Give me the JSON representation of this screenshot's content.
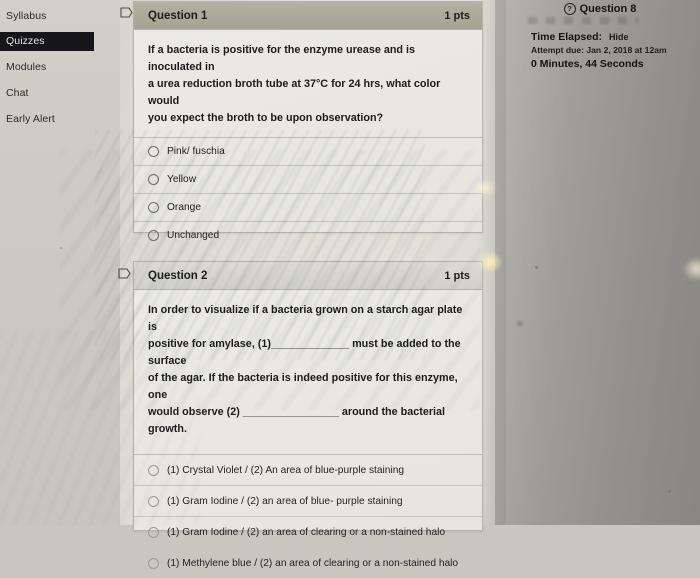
{
  "sidebar": {
    "items": [
      {
        "label": "Syllabus",
        "active": false
      },
      {
        "label": "Quizzes",
        "active": true
      },
      {
        "label": "Modules",
        "active": false
      },
      {
        "label": "Chat",
        "active": false
      },
      {
        "label": "Early Alert",
        "active": false
      }
    ]
  },
  "questions": [
    {
      "title": "Question 1",
      "points": "1 pts",
      "flag_icon": "flag-outline-icon",
      "header_style": "olive",
      "text_lines": [
        "If a bacteria is positive for the enzyme urease and is inoculated in",
        "a urea reduction broth tube at 37°C for 24 hrs, what color would",
        "you expect the broth to be upon observation?"
      ],
      "text": "If a bacteria is positive for the enzyme urease and is inoculated in a urea reduction broth tube at 37°C for 24 hrs, what color would you expect the broth to be upon observation?",
      "answers": [
        {
          "label": "Pink/ fuschia",
          "selected": false
        },
        {
          "label": "Yellow",
          "selected": false
        },
        {
          "label": "Orange",
          "selected": false
        },
        {
          "label": "Unchanged",
          "selected": false
        }
      ]
    },
    {
      "title": "Question 2",
      "points": "1 pts",
      "flag_icon": "flag-outline-icon",
      "header_style": "light",
      "text_lines": [
        "In order to visualize if a bacteria grown on a starch agar plate is",
        "positive for amylase, (1)_____________ must be added to the surface",
        "of the agar. If the bacteria is indeed positive for this enzyme, one",
        "would observe (2) ________________ around the bacterial growth."
      ],
      "text": "In order to visualize if a bacteria grown on a starch agar plate is positive for amylase, (1)_____________ must be added to the surface of the agar. If the bacteria is indeed positive for this enzyme, one would observe (2) ________________ around the bacterial growth.",
      "answers": [
        {
          "label": "(1) Crystal Violet / (2) An area of blue-purple staining",
          "selected": false
        },
        {
          "label": "(1) Gram Iodine / (2) an area of blue- purple staining",
          "selected": false
        },
        {
          "label": "(1) Gram Iodine / (2) an area of clearing or a non-stained halo",
          "selected": false
        },
        {
          "label": "(1) Methylene blue / (2) an area of clearing or a non-stained halo",
          "selected": false
        }
      ]
    }
  ],
  "right_panel": {
    "help_icon": "question-mark-circle-icon",
    "title": "Question 8",
    "time_elapsed_label": "Time Elapsed:",
    "hide_label": "Hide",
    "attempt_due": "Attempt due: Jan 2, 2018 at 12am",
    "elapsed_value": "0 Minutes, 44 Seconds"
  },
  "colors": {
    "page_background": "#dedbd4",
    "sidebar_active_bg": "#15151a",
    "sidebar_active_text": "#e6e4e0",
    "q1_header_bg": "#aaaa99",
    "q2_header_bg": "#d6d4ce",
    "card_bg": "#e9e7e1",
    "card_border": "#b5b3ad",
    "text": "#1b1b1b"
  }
}
